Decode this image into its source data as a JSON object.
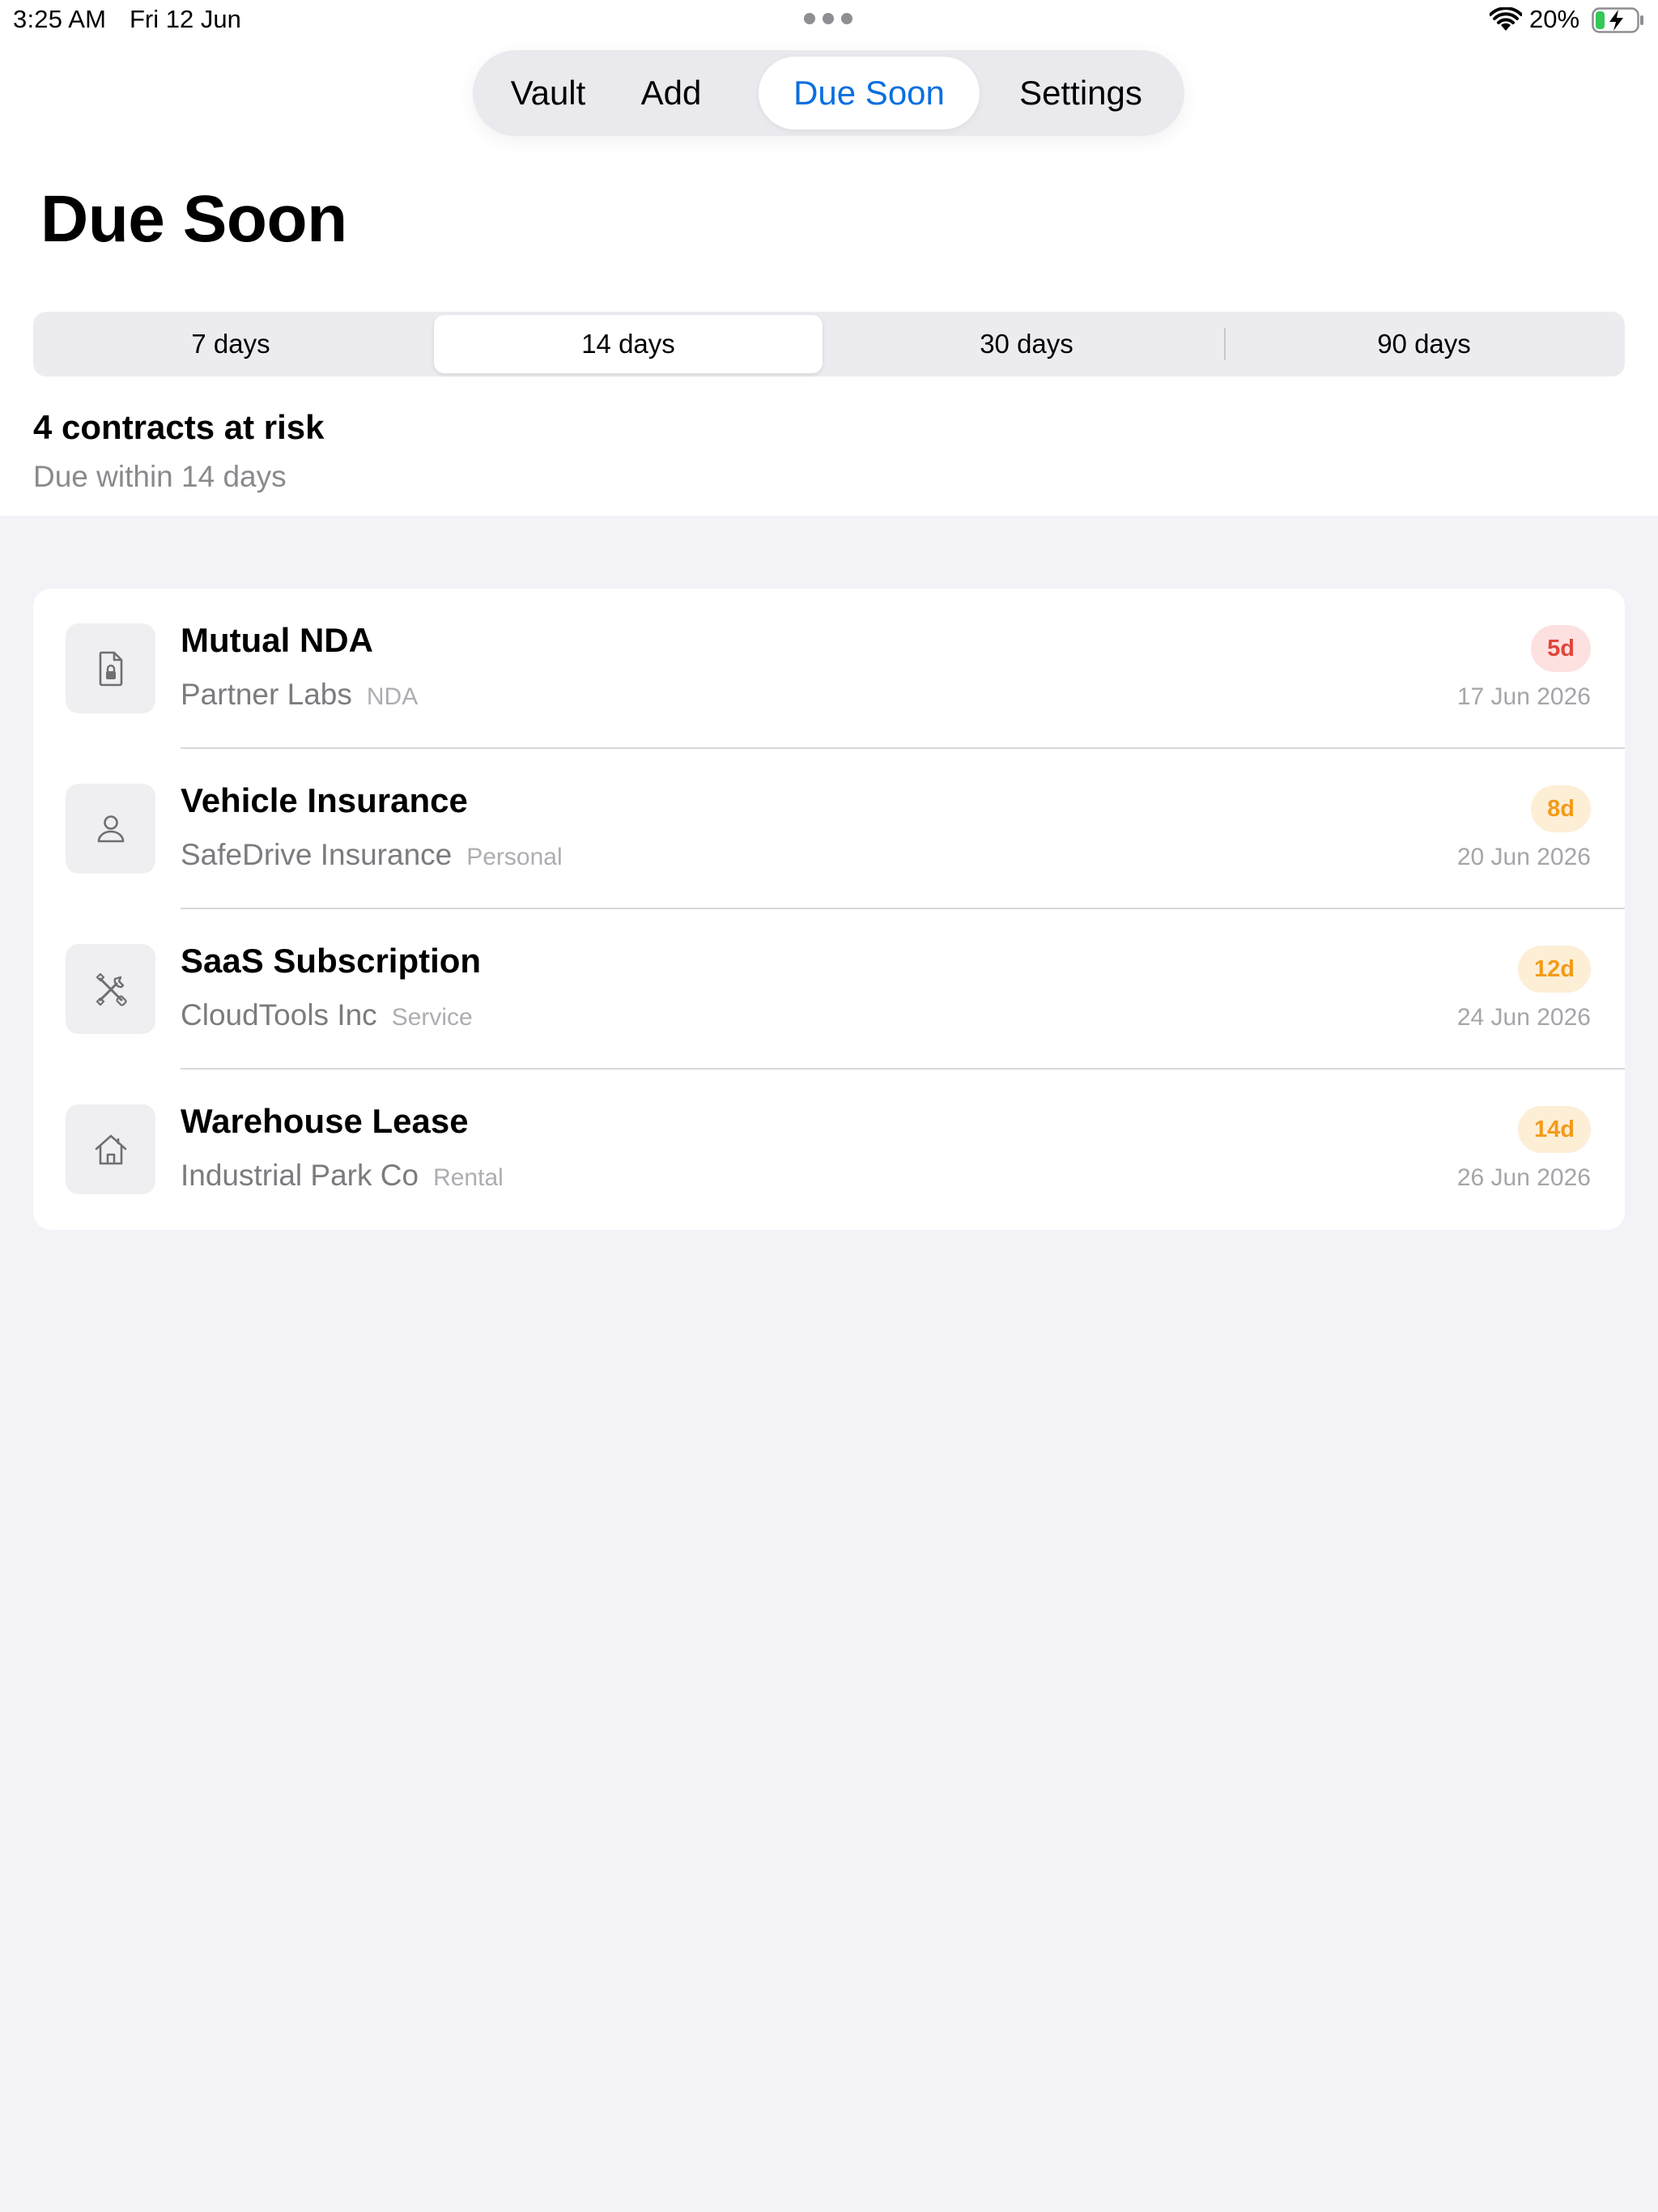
{
  "status_bar": {
    "time": "3:25 AM",
    "date": "Fri 12 Jun",
    "battery": "20%"
  },
  "tabs": [
    {
      "label": "Vault",
      "active": false
    },
    {
      "label": "Add",
      "active": false
    },
    {
      "label": "Due Soon",
      "active": true
    },
    {
      "label": "Settings",
      "active": false
    }
  ],
  "page_title": "Due Soon",
  "segments": [
    {
      "label": "7 days",
      "active": false
    },
    {
      "label": "14 days",
      "active": true
    },
    {
      "label": "30 days",
      "active": false
    },
    {
      "label": "90 days",
      "active": false
    }
  ],
  "summary": {
    "title": "4 contracts at risk",
    "subtitle": "Due within 14 days"
  },
  "contracts": [
    {
      "icon": "doc-lock-icon",
      "title": "Mutual NDA",
      "party": "Partner Labs",
      "category": "NDA",
      "badge": "5d",
      "badge_color": "#e0463b",
      "date": "17 Jun 2026"
    },
    {
      "icon": "person-icon",
      "title": "Vehicle Insurance",
      "party": "SafeDrive Insurance",
      "category": "Personal",
      "badge": "8d",
      "badge_color": "#f29b1a",
      "date": "20 Jun 2026"
    },
    {
      "icon": "tools-icon",
      "title": "SaaS Subscription",
      "party": "CloudTools Inc",
      "category": "Service",
      "badge": "12d",
      "badge_color": "#f29b1a",
      "date": "24 Jun 2026"
    },
    {
      "icon": "house-icon",
      "title": "Warehouse Lease",
      "party": "Industrial Park Co",
      "category": "Rental",
      "badge": "14d",
      "badge_color": "#f29b1a",
      "date": "26 Jun 2026"
    }
  ],
  "colors": {
    "accent": "#0a6fe0",
    "background": "#f2f2f7",
    "urgent": "#e0463b",
    "warning": "#f29b1a"
  }
}
